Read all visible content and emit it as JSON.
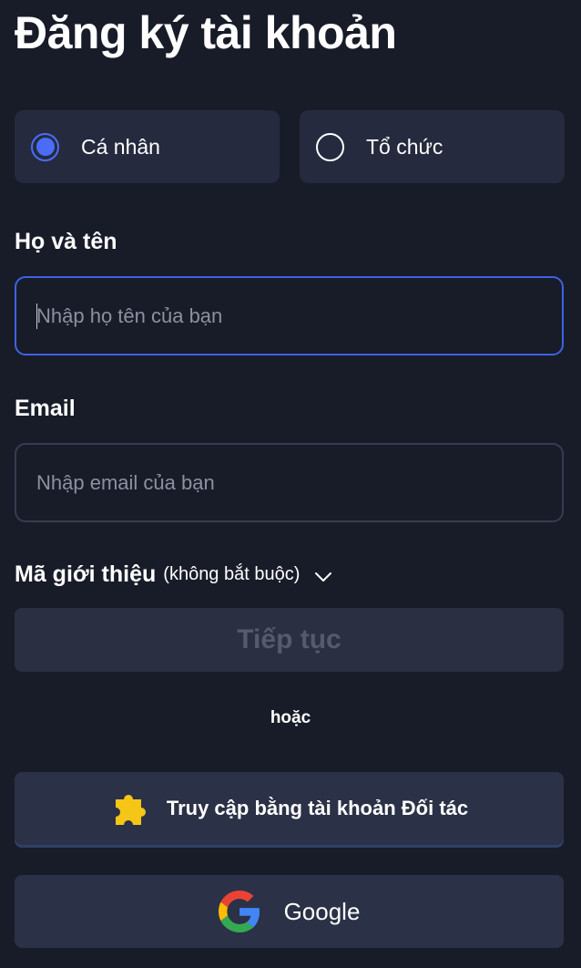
{
  "page": {
    "title": "Đăng ký tài khoản"
  },
  "account_type": {
    "options": [
      {
        "label": "Cá nhân",
        "selected": true
      },
      {
        "label": "Tổ chức",
        "selected": false
      }
    ]
  },
  "name_field": {
    "label": "Họ và tên",
    "placeholder": "Nhập họ tên của bạn",
    "value": ""
  },
  "email_field": {
    "label": "Email",
    "placeholder": "Nhập email của bạn",
    "value": ""
  },
  "referral": {
    "label": "Mã giới thiệu",
    "optional_note": "(không bắt buộc)"
  },
  "continue_button": {
    "label": "Tiếp tục"
  },
  "divider": {
    "text": "hoặc"
  },
  "partner_button": {
    "label": "Truy cập bằng tài khoản Đối tác",
    "icon": "puzzle-icon"
  },
  "google_button": {
    "label": "Google",
    "icon": "google-icon"
  },
  "colors": {
    "background": "#181c29",
    "card": "#252a3e",
    "accent": "#4a6cf7",
    "puzzle": "#f5c518"
  }
}
